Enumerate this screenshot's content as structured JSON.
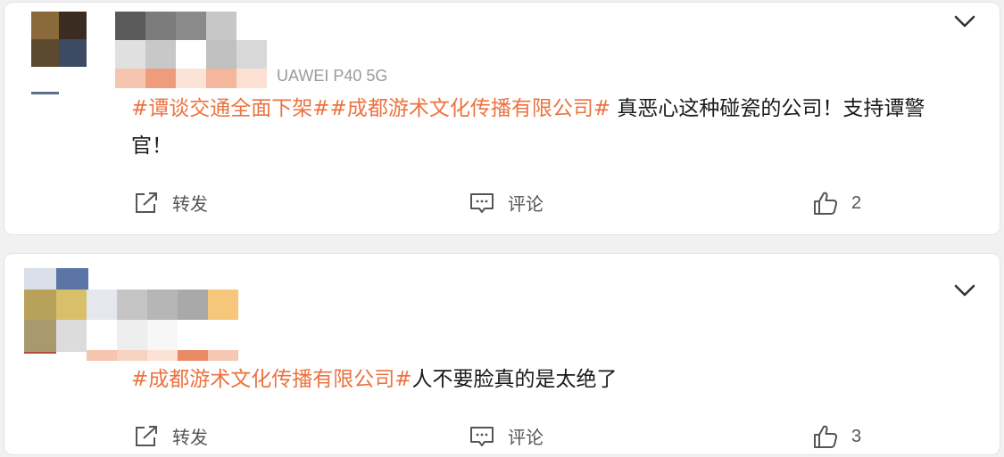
{
  "posts": [
    {
      "source": "UAWEI P40 5G",
      "tag_1": "#谭谈交通全面下架#",
      "tag_2": "#成都游术文化传播有限公司#",
      "text": " 真恶心这种碰瓷的公司！支持谭警官！",
      "repost_label": "转发",
      "comment_label": "评论",
      "like_count": "2"
    },
    {
      "tag_1": "#成都游术文化传播有限公司#",
      "text": "人不要脸真的是太绝了",
      "repost_label": "转发",
      "comment_label": "评论",
      "like_count": "3"
    }
  ],
  "icons": {
    "expand": "chevron-down-icon",
    "repost": "repost-icon",
    "comment": "comment-icon",
    "like": "thumbs-up-icon"
  },
  "colors": {
    "hashtag": "#eb7340",
    "text": "#1a1a1a",
    "secondary": "#555555"
  }
}
